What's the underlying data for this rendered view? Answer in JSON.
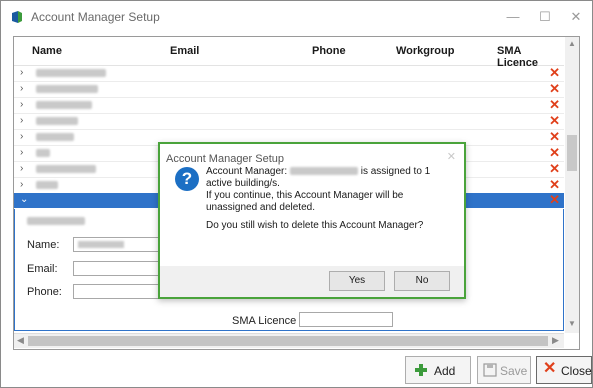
{
  "window": {
    "title": "Account Manager Setup",
    "minimize_glyph": "—",
    "maximize_glyph": "☐",
    "close_glyph": "✕"
  },
  "grid": {
    "columns": [
      "Name",
      "Email",
      "Phone",
      "Workgroup",
      "SMA Licence"
    ],
    "row_count_visible": 8,
    "expand_glyph": "›",
    "collapse_glyph": "⌄",
    "delete_glyph": "✕"
  },
  "detail": {
    "name_label": "Name:",
    "email_label": "Email:",
    "phone_label": "Phone:",
    "sma_licence_label": "SMA Licence :"
  },
  "buttons": {
    "add": "Add",
    "save": "Save",
    "close": "Close"
  },
  "dialog": {
    "title": "Account Manager Setup",
    "close_glyph": "✕",
    "icon_glyph": "?",
    "msg_prefix": "Account Manager:",
    "msg_suffix": "is assigned to 1 active building/s.",
    "msg_line2": "If you continue, this Account Manager will be unassigned and deleted.",
    "msg_question": "Do you still wish to delete this Account Manager?",
    "yes": "Yes",
    "no": "No"
  },
  "colors": {
    "accent": "#2f73c9",
    "delete": "#e0401b",
    "dialog_border": "#4aa33b",
    "question_icon": "#1c6fc4"
  }
}
